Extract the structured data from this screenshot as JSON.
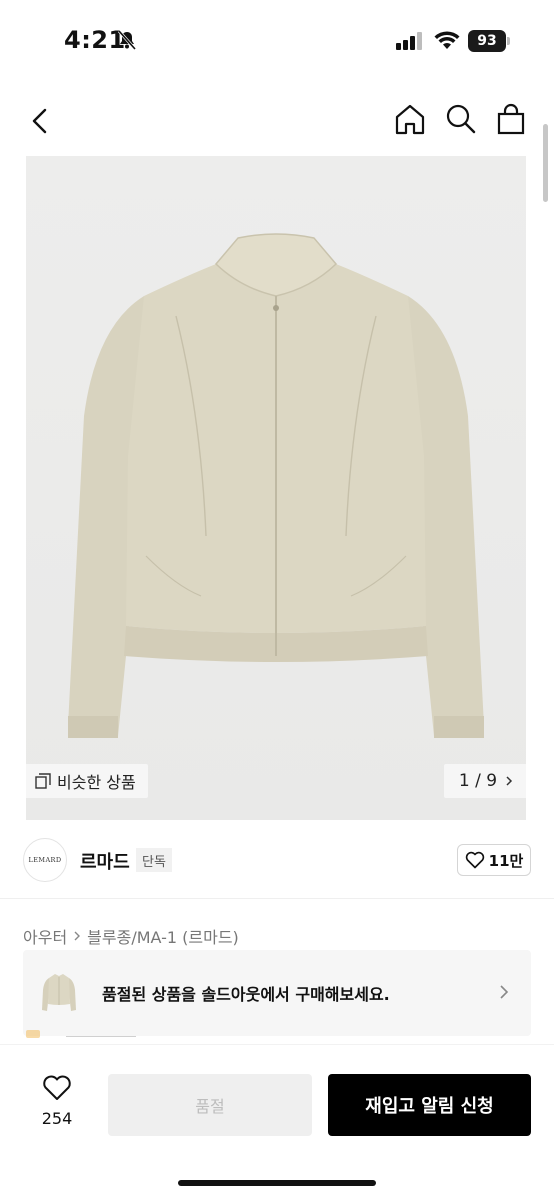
{
  "status_bar": {
    "time": "4:21",
    "battery": "93"
  },
  "nav": {
    "icons": [
      "chevron-left-icon",
      "home-icon",
      "search-icon",
      "shopping-bag-icon"
    ]
  },
  "product_image": {
    "similar_label": "비슷한 상품",
    "counter_current": "1",
    "counter_separator": "/",
    "counter_total": "9"
  },
  "brand": {
    "logo_text": "LEMARD",
    "name": "르마드",
    "tag": "단독",
    "likes": "11만"
  },
  "breadcrumb": {
    "category": "아우터",
    "subcategory": "블루종/MA-1 (르마드)"
  },
  "soldout_banner": {
    "message": "품절된 상품을 솔드아웃에서 구매해보세요."
  },
  "bottom_bar": {
    "wish_count": "254",
    "soldout_label": "품절",
    "restock_label": "재입고 알림 신청"
  },
  "colors": {
    "accent": "#000000",
    "jacket": "#d9d4c0",
    "background_image": "#ececeb"
  }
}
